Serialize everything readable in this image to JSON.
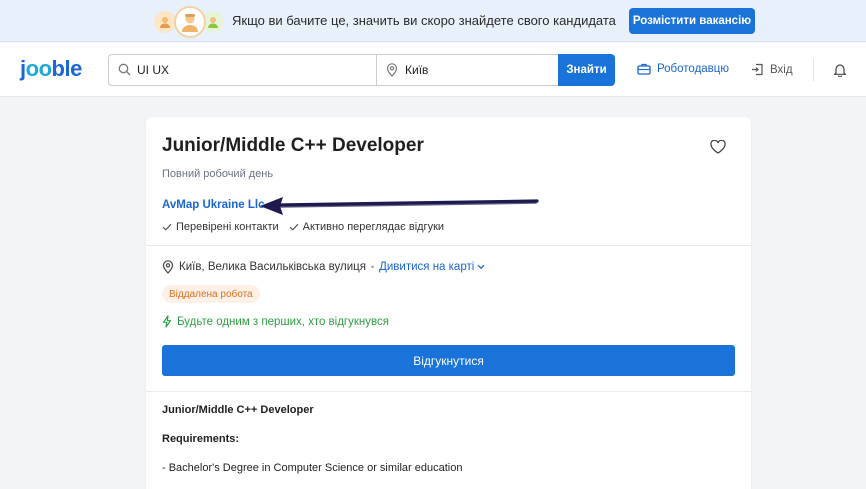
{
  "banner": {
    "text": "Якщо ви бачите це, значить ви скоро знайдете свого кандидата",
    "post_button": "Розмістити вакансію"
  },
  "header": {
    "logo_prefix": "j",
    "logo_oo": "oo",
    "logo_suffix": "ble",
    "search_value": "UI UX",
    "location_value": "Київ",
    "find_button": "Знайти",
    "employer_link": "Роботодавцю",
    "login_link": "Вхід"
  },
  "job": {
    "title": "Junior/Middle C++ Developer",
    "employment_type": "Повний робочий день",
    "company": "AvMap Ukraine Llc",
    "badges": [
      "Перевірені контакти",
      "Активно переглядає відгуки"
    ],
    "location": "Київ, Велика Васильківська вулиця",
    "location_separator": "•",
    "map_link": "Дивитися на карті",
    "remote_tag": "Віддалена робота",
    "be_first": "Будьте одним з перших, хто відгукнувся",
    "apply_button": "Відгукнутися",
    "description_title": "Junior/Middle C++ Developer",
    "requirements_title": "Requirements:",
    "requirements": [
      "- Bachelor's Degree in Computer Science or similar education"
    ]
  },
  "colors": {
    "accent": "#1a73d9",
    "link": "#1a66d4",
    "success": "#2e9e44",
    "tag_bg": "#fdf0e6",
    "tag_text": "#e0701f",
    "annotation_arrow": "#1c1a4e"
  }
}
